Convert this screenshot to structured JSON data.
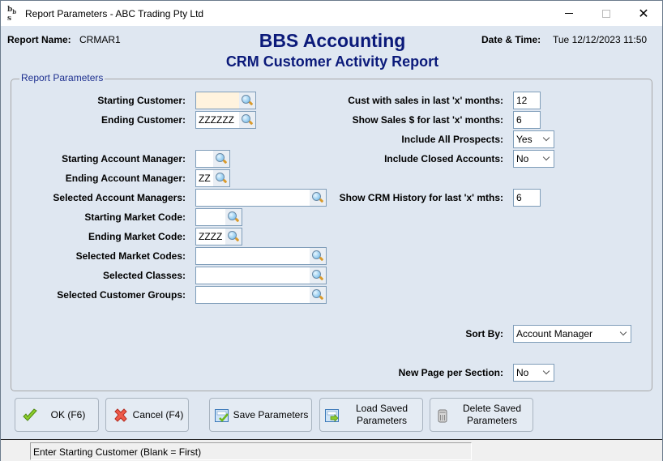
{
  "window": {
    "title": "Report Parameters - ABC Trading Pty Ltd",
    "app_icon_text": "bbs",
    "controls": {
      "minimize": "–",
      "maximize": "□",
      "close": "✕"
    }
  },
  "header": {
    "report_name_label": "Report Name:",
    "report_name_value": "CRMAR1",
    "brand": "BBS Accounting",
    "report_title": "CRM Customer Activity Report",
    "datetime_label": "Date & Time:",
    "datetime_value": "Tue 12/12/2023 11:50"
  },
  "panel": {
    "legend": "Report Parameters",
    "left_fields": [
      {
        "label": "Starting Customer:",
        "value": "",
        "type": "lookup",
        "active": true
      },
      {
        "label": "Ending Customer:",
        "value": "ZZZZZZ",
        "type": "lookup"
      },
      {
        "label": "Starting Account Manager:",
        "value": "",
        "type": "lookup"
      },
      {
        "label": "Ending Account Manager:",
        "value": "ZZ",
        "type": "lookup"
      },
      {
        "label": "Selected Account Managers:",
        "value": "",
        "type": "lookup"
      },
      {
        "label": "Starting Market Code:",
        "value": "",
        "type": "lookup"
      },
      {
        "label": "Ending Market Code:",
        "value": "ZZZZ",
        "type": "lookup"
      },
      {
        "label": "Selected Market Codes:",
        "value": "",
        "type": "lookup"
      },
      {
        "label": "Selected Classes:",
        "value": "",
        "type": "lookup"
      },
      {
        "label": "Selected Customer Groups:",
        "value": "",
        "type": "lookup"
      }
    ],
    "right_fields": [
      {
        "label": "Cust with sales in last 'x' months:",
        "value": "12",
        "type": "text"
      },
      {
        "label": "Show Sales $ for last 'x' months:",
        "value": "6",
        "type": "text"
      },
      {
        "label": "Include All Prospects:",
        "value": "Yes",
        "type": "select"
      },
      {
        "label": "Include Closed Accounts:",
        "value": "No",
        "type": "select"
      },
      {
        "label": "Show CRM History for last 'x' mths:",
        "value": "6",
        "type": "text"
      },
      {
        "label": "Sort By:",
        "value": "Account Manager",
        "type": "select"
      },
      {
        "label": "New Page per Section:",
        "value": "No",
        "type": "select"
      }
    ]
  },
  "buttons": {
    "ok": "OK (F6)",
    "cancel": "Cancel (F4)",
    "save": "Save Parameters",
    "load_line1": "Load Saved",
    "load_line2": "Parameters",
    "delete_line1": "Delete Saved",
    "delete_line2": "Parameters"
  },
  "status": {
    "message": "Enter Starting Customer (Blank = First)"
  },
  "colors": {
    "brand": "#0b1a7a",
    "legend": "#1d2f8f",
    "background": "#dfe7f1",
    "active_field": "#fff3de"
  }
}
